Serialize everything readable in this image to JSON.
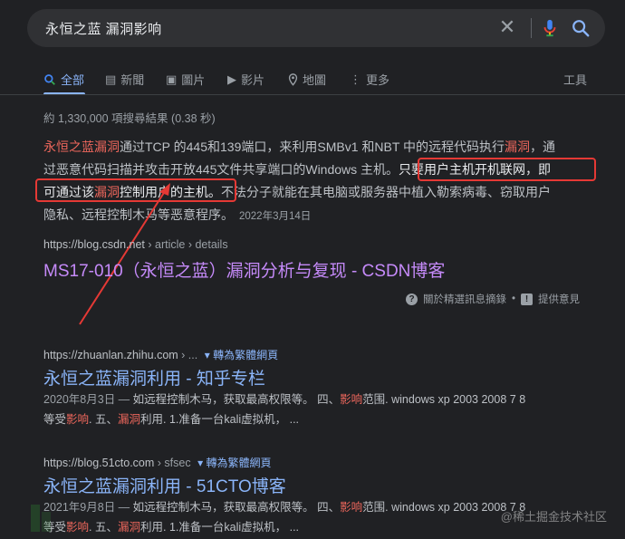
{
  "search": {
    "query": "永恒之蓝  漏洞影响",
    "clear_icon": "close-icon",
    "mic_icon": "microphone-icon",
    "search_icon": "search-icon"
  },
  "tabs": [
    {
      "label": "全部",
      "icon": "search-icon"
    },
    {
      "label": "新聞",
      "icon": "news-icon"
    },
    {
      "label": "圖片",
      "icon": "image-icon"
    },
    {
      "label": "影片",
      "icon": "video-icon"
    },
    {
      "label": "地圖",
      "icon": "map-pin-icon"
    },
    {
      "label": "更多",
      "icon": "more-icon"
    }
  ],
  "tools_label": "工具",
  "stats": "約 1,330,000 項搜尋結果 (0.38 秒)",
  "snippet": {
    "line1_a": "永恒之蓝漏洞",
    "line1_b": "通过TCP 的445和139端口，来利用SMBv1 和NBT 中的远程代码执行",
    "line1_c": "漏洞",
    "line1_d": "，通",
    "line2_a": "过恶意代码扫描并攻击开放445文件共享端口的Windows 主机。",
    "line2_b": "只要用户主机开机联网，即",
    "line3_a": "可通过该",
    "line3_b": "漏洞",
    "line3_c": "控制用户的主机。",
    "line3_d": "不法分子就能在其电脑或服务器中植入勒索病毒、窃取用户",
    "line4": "隐私、远程控制木马等恶意程序。",
    "date": "2022年3月14日"
  },
  "result1": {
    "domain": "https://blog.csdn.net",
    "path": " › article › details",
    "title": "MS17-010（永恒之蓝）漏洞分析与复现 - CSDN博客"
  },
  "feedback": {
    "about": "關於精選訊息摘錄",
    "sep": "•",
    "report": "提供意見"
  },
  "result2": {
    "domain": "https://zhuanlan.zhihu.com",
    "path": " › ...",
    "translate": "轉為繁體網頁",
    "title": "永恒之蓝漏洞利用 - 知乎专栏",
    "d1_date": "2020年8月3日 — ",
    "d1_a": "如远程控制木马，获取最高权限等。 四、",
    "d1_hl": "影响",
    "d1_b": "范围. windows xp 2003 2008 7 8",
    "d2_a": "等受",
    "d2_hl1": "影响",
    "d2_b": ". 五、",
    "d2_hl2": "漏洞",
    "d2_c": "利用. 1.准备一台kali虚拟机， ..."
  },
  "result3": {
    "domain": "https://blog.51cto.com",
    "path": " › sfsec",
    "translate": "轉為繁體網頁",
    "title": "永恒之蓝漏洞利用 - 51CTO博客",
    "d1_date": "2021年9月8日 — ",
    "d1_a": "如远程控制木马，获取最高权限等。 四、",
    "d1_hl": "影响",
    "d1_b": "范围. windows xp 2003 2008 7 8",
    "d2_a": "等受",
    "d2_hl1": "影响",
    "d2_b": ". 五、",
    "d2_hl2": "漏洞",
    "d2_c": "利用. 1.准备一台kali虚拟机， ..."
  },
  "watermark": "@稀土掘金技术社区",
  "annotation_color": "#e53935"
}
